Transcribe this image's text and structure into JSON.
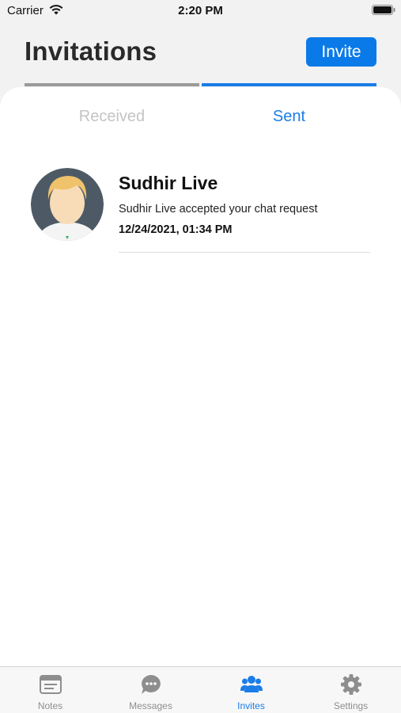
{
  "status_bar": {
    "carrier": "Carrier",
    "time": "2:20 PM"
  },
  "header": {
    "title": "Invitations",
    "invite_label": "Invite"
  },
  "tabs": [
    {
      "label": "Received",
      "active": false
    },
    {
      "label": "Sent",
      "active": true
    }
  ],
  "invitations": [
    {
      "name": "Sudhir Live",
      "message": "Sudhir Live accepted your chat request",
      "date": "12/24/2021, 01:34 PM",
      "avatar_icon": "user-avatar-icon"
    }
  ],
  "tab_bar": {
    "items": [
      {
        "label": "Notes",
        "icon": "notes-icon",
        "active": false
      },
      {
        "label": "Messages",
        "icon": "messages-icon",
        "active": false
      },
      {
        "label": "Invites",
        "icon": "invites-icon",
        "active": true
      },
      {
        "label": "Settings",
        "icon": "gear-icon",
        "active": false
      }
    ]
  },
  "colors": {
    "accent": "#1a7de8",
    "button": "#0a7ae8",
    "inactive": "#8e8e8e"
  }
}
